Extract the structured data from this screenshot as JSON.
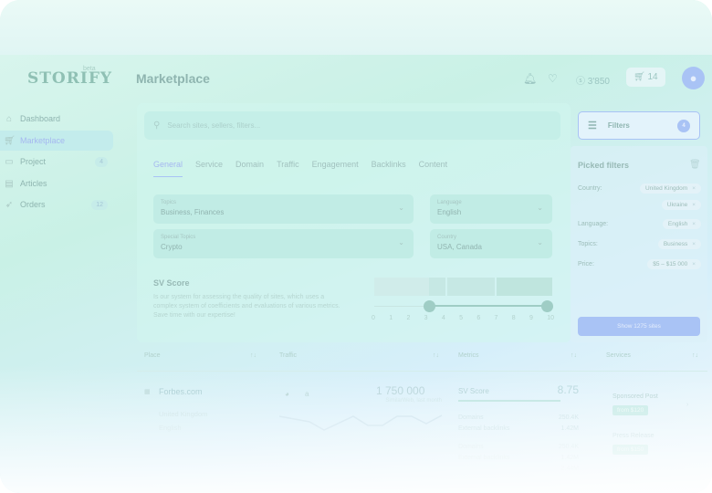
{
  "app": {
    "logo": "STORIFY",
    "beta": "beta",
    "page_title": "Marketplace"
  },
  "sidebar": {
    "items": [
      {
        "label": "Dashboard",
        "icon": "home-icon"
      },
      {
        "label": "Marketplace",
        "icon": "cart-icon",
        "active": true
      },
      {
        "label": "Project",
        "icon": "folder-icon",
        "badge": "4"
      },
      {
        "label": "Articles",
        "icon": "document-icon"
      },
      {
        "label": "Orders",
        "icon": "rocket-icon",
        "badge": "12"
      }
    ]
  },
  "header": {
    "balance": "3'850",
    "cart_count": "14"
  },
  "search": {
    "placeholder": "Search sites, sellers, filters..."
  },
  "filters_button": {
    "label": "Filters",
    "count": "4"
  },
  "tabs": [
    "General",
    "Service",
    "Domain",
    "Traffic",
    "Engagement",
    "Backlinks",
    "Content"
  ],
  "fields": {
    "topics": {
      "label": "Topics",
      "value": "Business, Finances"
    },
    "language": {
      "label": "Language",
      "value": "English"
    },
    "special_topics": {
      "label": "Special Topics",
      "value": "Crypto"
    },
    "country": {
      "label": "Country",
      "value": "USA, Canada"
    }
  },
  "sv_score": {
    "title": "SV Score",
    "description": "Is our system for assessing the quality of sites, which uses a complex system of coefficients and evaluations of various metrics. Save time with our expertise!",
    "ticks": [
      "0",
      "1",
      "2",
      "3",
      "4",
      "5",
      "6",
      "7",
      "8",
      "9",
      "10"
    ],
    "range_min": 3,
    "range_max": 10
  },
  "picked_filters": {
    "title": "Picked filters",
    "rows": [
      {
        "label": "Country:",
        "chips": [
          "United Kingdom",
          "Ukraine"
        ]
      },
      {
        "label": "Language:",
        "chips": [
          "English"
        ]
      },
      {
        "label": "Topics:",
        "chips": [
          "Business"
        ]
      },
      {
        "label": "Price:",
        "chips": [
          "$5 – $15 000"
        ]
      }
    ],
    "show_button": "Show 1275 sites"
  },
  "table": {
    "headers": [
      "Place",
      "Traffic",
      "Metrics",
      "Services"
    ],
    "row": {
      "site": "Forbes.com",
      "country": "United Kingdom",
      "language": "English",
      "traffic": "1 750 000",
      "traffic_source": "SimilarWeb, last month",
      "sv_label": "SV Score",
      "sv_value": "8.75",
      "sv_fraction": 0.92,
      "metrics": [
        {
          "label": "Domains",
          "value": "250.4K"
        },
        {
          "label": "External backlinks",
          "value": "1.42M"
        },
        {
          "label": "Domains",
          "value": "250.4K"
        },
        {
          "label": "External backlinks",
          "value": "1.42M"
        },
        {
          "label": "",
          "value": "2.44M"
        }
      ],
      "services": [
        {
          "name": "Sponsored Post",
          "price": "from $120"
        },
        {
          "name": "Press Release",
          "price": "from $150"
        }
      ]
    }
  },
  "colors": {
    "accent": "#a9c3f5",
    "text": "#8fb5b0",
    "bg_mint": "#c9f1e6"
  }
}
